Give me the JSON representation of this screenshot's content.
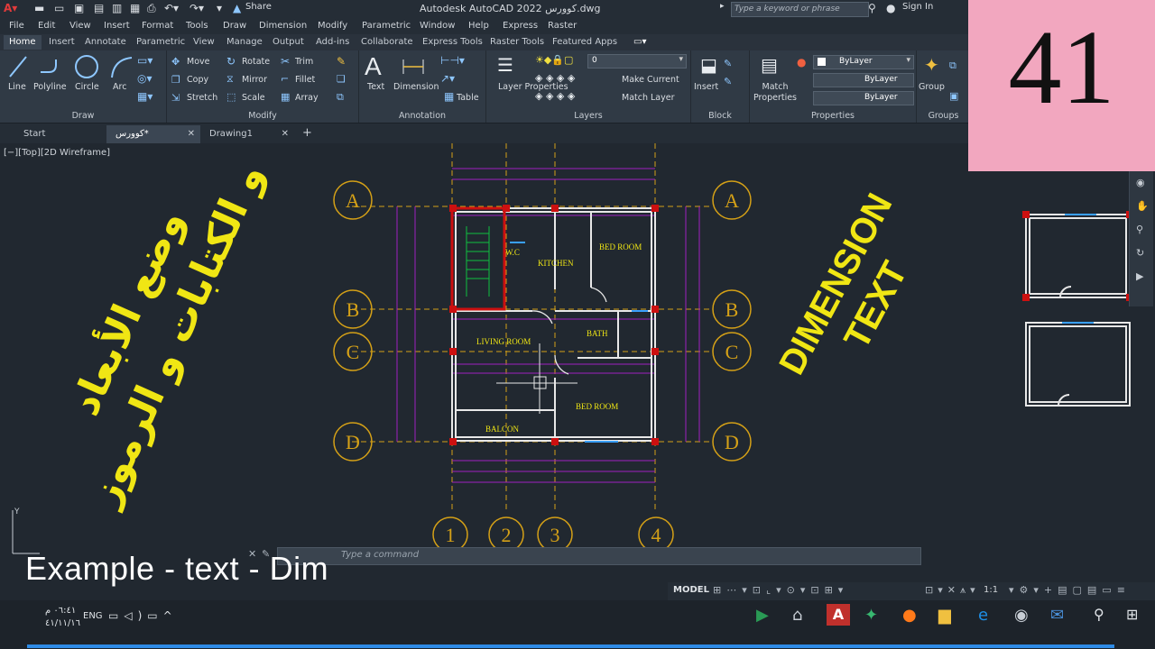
{
  "window": {
    "title": "Autodesk AutoCAD 2022   كوورس.dwg",
    "share": "Share",
    "search_placeholder": "Type a keyword or phrase",
    "sign_in": "Sign In"
  },
  "menu": [
    "File",
    "Edit",
    "View",
    "Insert",
    "Format",
    "Tools",
    "Draw",
    "Dimension",
    "Modify",
    "Parametric",
    "Window",
    "Help",
    "Express",
    "Raster"
  ],
  "ribbon_tabs": [
    "Home",
    "Insert",
    "Annotate",
    "Parametric",
    "View",
    "Manage",
    "Output",
    "Add-ins",
    "Collaborate",
    "Express Tools",
    "Raster Tools",
    "Featured Apps"
  ],
  "ribbon": {
    "draw": {
      "label": "Draw",
      "tools": [
        "Line",
        "Polyline",
        "Circle",
        "Arc"
      ]
    },
    "modify": {
      "label": "Modify",
      "tools": [
        "Move",
        "Rotate",
        "Trim",
        "Copy",
        "Mirror",
        "Fillet",
        "Stretch",
        "Scale",
        "Array"
      ]
    },
    "annotation": {
      "label": "Annotation",
      "tools": [
        "Text",
        "Dimension",
        "Table"
      ]
    },
    "layers": {
      "label": "Layers",
      "tools": [
        "Layer Properties",
        "Make Current",
        "Match Layer"
      ],
      "current": "0"
    },
    "block": {
      "label": "Block",
      "tools": [
        "Insert"
      ]
    },
    "properties": {
      "label": "Properties",
      "tools": [
        "Match Properties"
      ],
      "values": [
        "ByLayer",
        "ByLayer",
        "ByLayer"
      ]
    },
    "groups": {
      "label": "Groups",
      "tools": [
        "Group"
      ]
    }
  },
  "file_tabs": [
    {
      "label": "Start"
    },
    {
      "label": "كوورس*"
    },
    {
      "label": "Drawing1"
    }
  ],
  "viewport_label": "[−][Top][2D Wireframe]",
  "plan": {
    "grid_rows": [
      "A",
      "B",
      "C",
      "D"
    ],
    "grid_cols": [
      "1",
      "2",
      "3",
      "4"
    ],
    "rooms": [
      "W.C",
      "KITCHEN",
      "BED ROOM",
      "LIVING ROOM",
      "BATH",
      "BED ROOM",
      "BALCON"
    ]
  },
  "overlay": {
    "number": "41",
    "arabic_line1": "وضع الأبعاد",
    "arabic_line2": "و الكتابات و الرموز",
    "dimension_line1": "DIMENSION",
    "dimension_line2": "TEXT",
    "caption": "Example - text - Dim"
  },
  "command_placeholder": "Type a command",
  "status": {
    "model": "MODEL",
    "scale": "1:1"
  },
  "taskbar": {
    "time": "٠٦:٤١ م",
    "date": "٤١/١١/١٦",
    "lang": "ENG"
  },
  "colors": {
    "ribbon_bg": "#303a45",
    "canvas_bg": "#212830",
    "accent_yellow": "#f0e614",
    "grid_gold": "#d4a017",
    "wall_purple": "#a020c0",
    "column_red": "#cc1010",
    "badge_pink": "#f2a7bf"
  }
}
